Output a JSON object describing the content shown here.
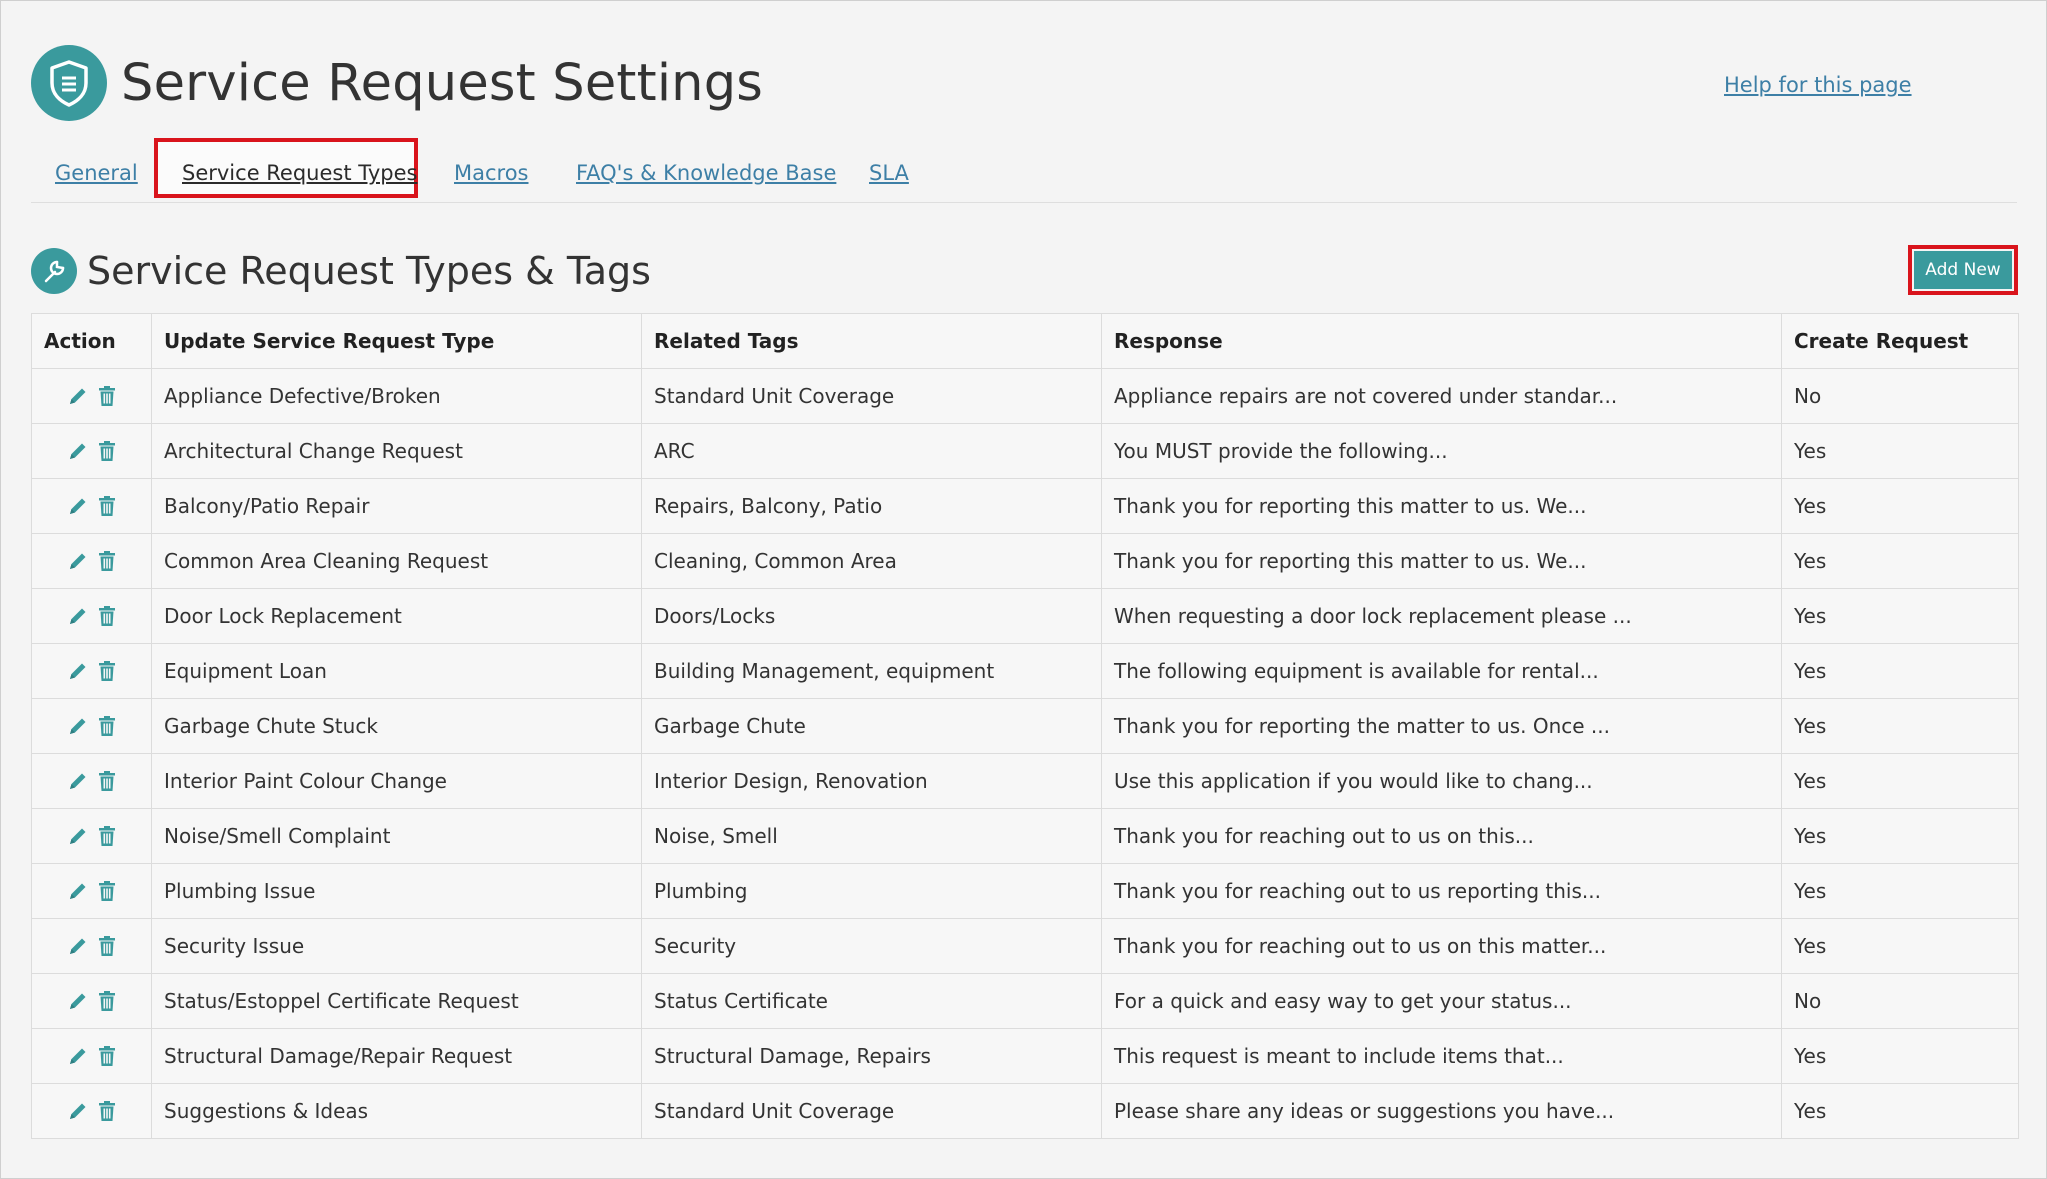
{
  "page": {
    "title": "Service Request Settings",
    "help_link": "Help for this page"
  },
  "tabs": [
    {
      "label": "General",
      "active": false
    },
    {
      "label": "Service Request Types",
      "active": true
    },
    {
      "label": "Macros",
      "active": false
    },
    {
      "label": "FAQ's & Knowledge Base",
      "active": false
    },
    {
      "label": "SLA",
      "active": false
    }
  ],
  "section": {
    "title": "Service Request Types & Tags",
    "add_button": "Add New"
  },
  "table": {
    "headers": [
      "Action",
      "Update Service Request Type",
      "Related Tags",
      "Response",
      "Create Request"
    ],
    "rows": [
      {
        "type": "Appliance Defective/Broken",
        "tags": "Standard Unit Coverage",
        "response": "Appliance repairs are not covered under standar...",
        "create": "No"
      },
      {
        "type": "Architectural Change Request",
        "tags": "ARC",
        "response": "You MUST provide the following...",
        "create": "Yes"
      },
      {
        "type": "Balcony/Patio Repair",
        "tags": "Repairs, Balcony, Patio",
        "response": "Thank you for reporting this matter to us. We...",
        "create": "Yes"
      },
      {
        "type": "Common Area Cleaning Request",
        "tags": "Cleaning, Common Area",
        "response": "Thank you for reporting this matter to us. We...",
        "create": "Yes"
      },
      {
        "type": "Door Lock Replacement",
        "tags": "Doors/Locks",
        "response": "When requesting a door lock replacement please ...",
        "create": "Yes"
      },
      {
        "type": "Equipment Loan",
        "tags": "Building Management, equipment",
        "response": "The following equipment is available for rental...",
        "create": "Yes"
      },
      {
        "type": "Garbage Chute Stuck",
        "tags": "Garbage Chute",
        "response": "Thank you for reporting the matter to us. Once ...",
        "create": "Yes"
      },
      {
        "type": "Interior Paint Colour Change",
        "tags": "Interior Design, Renovation",
        "response": "Use this application if you would like to chang...",
        "create": "Yes"
      },
      {
        "type": "Noise/Smell Complaint",
        "tags": "Noise, Smell",
        "response": "Thank you for reaching out to us on this...",
        "create": "Yes"
      },
      {
        "type": "Plumbing Issue",
        "tags": "Plumbing",
        "response": "Thank you for reaching out to us reporting this...",
        "create": "Yes"
      },
      {
        "type": "Security Issue",
        "tags": "Security",
        "response": "Thank you for reaching out to us on this matter...",
        "create": "Yes"
      },
      {
        "type": "Status/Estoppel Certificate Request",
        "tags": "Status Certificate",
        "response": "For a quick and easy way to get your status...",
        "create": "No"
      },
      {
        "type": "Structural Damage/Repair Request",
        "tags": "Structural Damage, Repairs",
        "response": "This request is meant to include items that...",
        "create": "Yes"
      },
      {
        "type": "Suggestions & Ideas",
        "tags": "Standard Unit Coverage",
        "response": "Please share any ideas or suggestions you have...",
        "create": "Yes"
      }
    ]
  },
  "icons": {
    "logo": "shield-icon",
    "section": "wrench-icon",
    "edit": "pencil-icon",
    "delete": "trash-icon"
  },
  "colors": {
    "accent": "#3a9a9d",
    "link": "#3d7fa6",
    "highlight": "#d9141c"
  }
}
